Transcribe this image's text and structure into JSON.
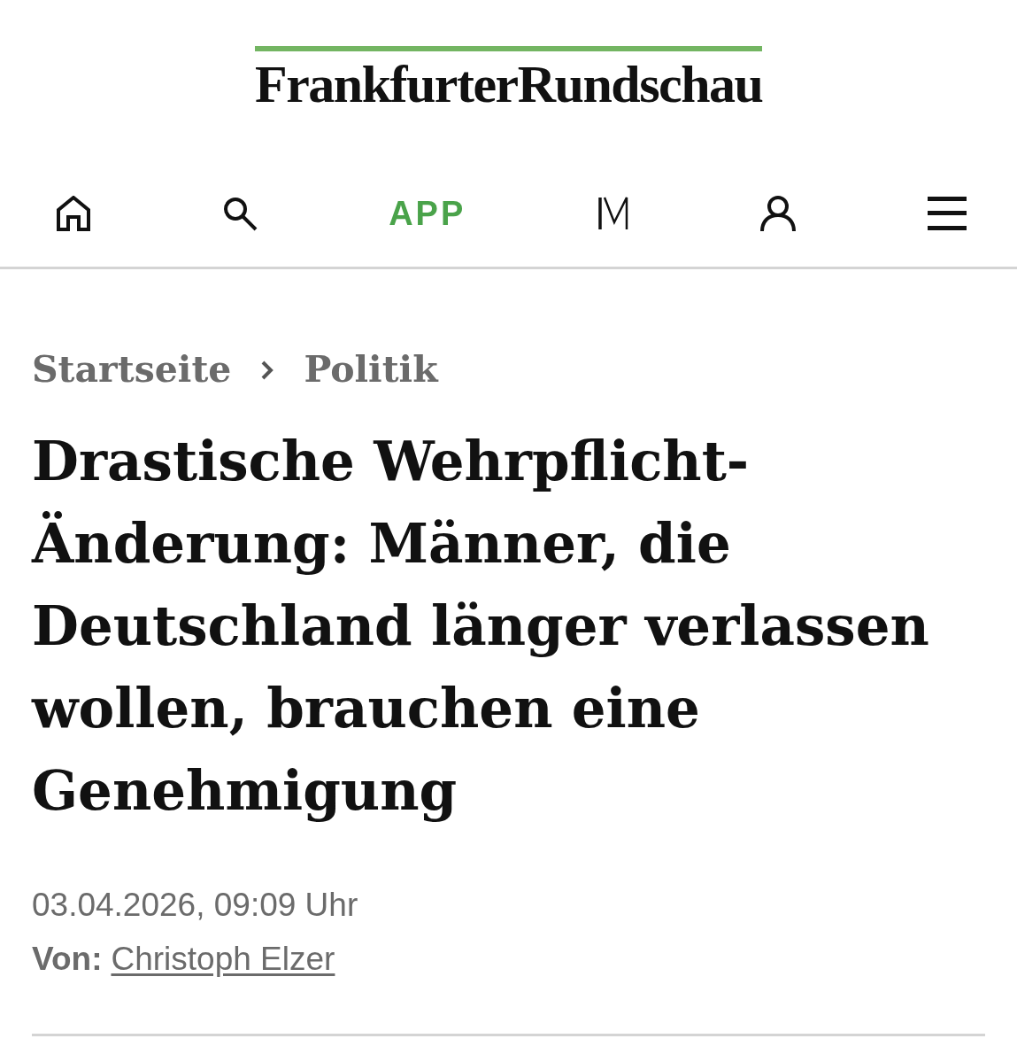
{
  "logo": {
    "text": "FrankfurterRundschau"
  },
  "nav": {
    "items": [
      {
        "kind": "home"
      },
      {
        "kind": "search"
      },
      {
        "kind": "text",
        "label": "APP"
      },
      {
        "kind": "m"
      },
      {
        "kind": "user"
      },
      {
        "kind": "menu"
      }
    ]
  },
  "breadcrumb": [
    {
      "label": "Startseite"
    },
    {
      "label": "Politik"
    }
  ],
  "headline": "Drastische Wehrpflicht-Änderung: Männer, die Deutschland länger verlassen wollen, brauchen eine Genehmigung",
  "date": "03.04.2026, 09:09 Uhr",
  "byline": {
    "label": "Von:",
    "author": "Christoph Elzer"
  }
}
